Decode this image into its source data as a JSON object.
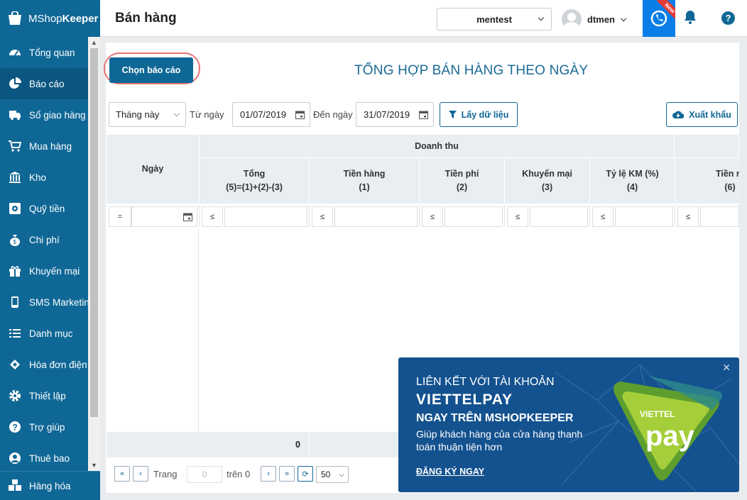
{
  "app": {
    "logo_prefix": "MShop",
    "logo_bold": "Keeper"
  },
  "sidebar": {
    "items": [
      {
        "label": "Tổng quan",
        "icon": "dashboard-icon"
      },
      {
        "label": "Báo cáo",
        "icon": "pie-chart-icon",
        "active": true
      },
      {
        "label": "Sổ giao hàng",
        "icon": "truck-icon"
      },
      {
        "label": "Mua hàng",
        "icon": "cart-icon"
      },
      {
        "label": "Kho",
        "icon": "warehouse-icon"
      },
      {
        "label": "Quỹ tiền",
        "icon": "safe-icon"
      },
      {
        "label": "Chi phí",
        "icon": "money-bag-icon"
      },
      {
        "label": "Khuyến mại",
        "icon": "gift-icon"
      },
      {
        "label": "SMS Marketing",
        "icon": "phone-icon"
      },
      {
        "label": "Danh mục",
        "icon": "list-icon"
      },
      {
        "label": "Hóa đơn điện tử",
        "icon": "invoice-icon"
      },
      {
        "label": "Thiết lập",
        "icon": "gear-icon"
      },
      {
        "label": "Trợ giúp",
        "icon": "help-icon"
      },
      {
        "label": "Thuê bao",
        "icon": "user-icon"
      }
    ],
    "bottom_item": "Hàng hóa"
  },
  "header": {
    "title": "Bán hàng",
    "store": "mentest",
    "username": "dtmen",
    "new_badge": "New"
  },
  "report": {
    "choose_button": "Chọn báo cáo",
    "title": "TỔNG HỢP BÁN HÀNG THEO NGÀY",
    "period": "Tháng này",
    "from_label": "Từ ngày",
    "from_date": "01/07/2019",
    "to_label": "Đến ngày",
    "to_date": "31/07/2019",
    "fetch_button": "Lấy dữ liệu",
    "export_button": "Xuất khẩu"
  },
  "table": {
    "date_header": "Ngày",
    "group_header": "Doanh thu",
    "columns": [
      {
        "name": "Tổng",
        "formula": "(5)=(1)+(2)-(3)"
      },
      {
        "name": "Tiền hàng",
        "formula": "(1)"
      },
      {
        "name": "Tiền phí",
        "formula": "(2)"
      },
      {
        "name": "Khuyến mại",
        "formula": "(3)"
      },
      {
        "name": "Tỷ lệ KM (%)",
        "formula": "(4)"
      },
      {
        "name": "Tiền m",
        "formula": "(6)"
      }
    ],
    "date_operator": "=",
    "filter_operator": "≤",
    "footer_total": "0"
  },
  "pager": {
    "page_label": "Trang",
    "page_value": "0",
    "of_label": "trên 0",
    "page_size": "50"
  },
  "promo": {
    "line1": "LIÊN KẾT VỚI TÀI KHOẢN",
    "line2": "VIETTELPAY",
    "line3": "NGAY TRÊN MSHOPKEEPER",
    "line4": "Giúp khách hàng của cửa hàng thanh toán thuận tiện hơn",
    "cta": "ĐĂNG KÝ NGAY",
    "logo_top": "VIETTEL",
    "logo_main": "pay"
  },
  "colors": {
    "primary": "#0f6796",
    "accent_blue": "#0a7ee8",
    "promo_bg": "#14528f",
    "logo_green": "#8bc34a"
  }
}
